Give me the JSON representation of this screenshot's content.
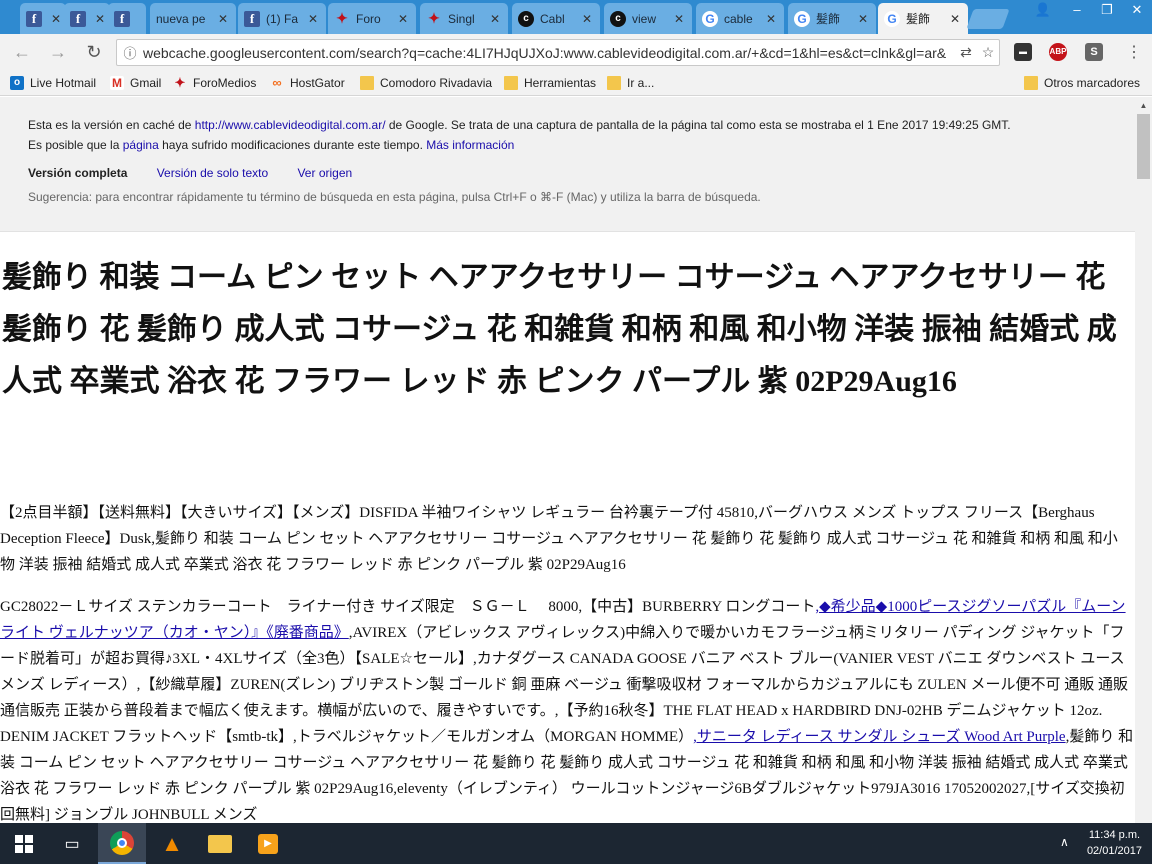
{
  "tabs": [
    {
      "icon": "f",
      "icon_kind": "facebook",
      "label": ""
    },
    {
      "icon": "f",
      "icon_kind": "facebook",
      "label": ""
    },
    {
      "icon": "f",
      "icon_kind": "facebook",
      "label": ""
    },
    {
      "icon": "",
      "icon_kind": "none",
      "label": "nueva pe"
    },
    {
      "icon": "f",
      "icon_kind": "facebook",
      "label": "(1) Fa"
    },
    {
      "icon": "✦",
      "icon_kind": "foromedios",
      "label": "Foro"
    },
    {
      "icon": "✦",
      "icon_kind": "foromedios",
      "label": "Singl"
    },
    {
      "icon": "c",
      "icon_kind": "cable",
      "label": "Cabl"
    },
    {
      "icon": "c",
      "icon_kind": "cable",
      "label": "view"
    },
    {
      "icon": "G",
      "icon_kind": "google",
      "label": "cable"
    },
    {
      "icon": "G",
      "icon_kind": "google",
      "label": "髪飾"
    },
    {
      "icon": "G",
      "icon_kind": "google",
      "label": "髪飾"
    }
  ],
  "address": {
    "url": "webcache.googleusercontent.com/search?q=cache:4LI7HJqUJXoJ:www.cablevideodigital.com.ar/+&cd=1&hl=es&ct=clnk&gl=ar&"
  },
  "extensions": [
    "ABP",
    "S"
  ],
  "bookmarks": [
    {
      "label": "Live Hotmail",
      "icon": "hotmail"
    },
    {
      "label": "Gmail",
      "icon": "gmail"
    },
    {
      "label": "ForoMedios",
      "icon": "foromedios"
    },
    {
      "label": "HostGator",
      "icon": "hostgator"
    },
    {
      "label": "Comodoro Rivadavia",
      "icon": "folder"
    },
    {
      "label": "Herramientas",
      "icon": "folder"
    },
    {
      "label": "Ir a...",
      "icon": "folder"
    },
    {
      "label": "Otros marcadores",
      "icon": "folder"
    }
  ],
  "cache_notice": {
    "prefix": "Esta es la versión en caché de ",
    "site_link": "http://www.cablevideodigital.com.ar/",
    "suffix": " de Google. Se trata de una captura de pantalla de la página tal como esta se mostraba el 1 Ene 2017 19:49:25 GMT.",
    "line2_prefix": "Es posible que la ",
    "line2_link": "página",
    "line2_middle": " haya sufrido modificaciones durante este tiempo. ",
    "line2_more": "Más información",
    "full_version": "Versión completa",
    "text_version": "Versión de solo texto",
    "view_source": "Ver origen",
    "tip": "Sugerencia: para encontrar rápidamente tu término de búsqueda en esta página, pulsa Ctrl+F o ⌘-F (Mac) y utiliza la barra de búsqueda."
  },
  "page": {
    "heading": "髪飾り 和装 コーム ピン セット ヘアアクセサリー コサージュ ヘアアクセサリー 花 髪飾り 花 髪飾り 成人式 コサージュ 花 和雑貨 和柄 和風 和小物 洋装 振袖 結婚式 成人式 卒業式 浴衣 花 フラワー レッド 赤 ピンク パープル 紫 02P29Aug16",
    "para1": "【2点目半額】【送料無料】【大きいサイズ】【メンズ】DISFIDA 半袖ワイシャツ レギュラー 台衿裏テープ付 45810,バーグハウス メンズ トップス フリース【Berghaus Deception Fleece】Dusk,髪飾り 和装 コーム ピン セット ヘアアクセサリー コサージュ ヘアアクセサリー 花 髪飾り 花 髪飾り 成人式 コサージュ 花 和雑貨 和柄 和風 和小物 洋装 振袖 結婚式 成人式 卒業式 浴衣 花 フラワー レッド 赤 ピンク パープル 紫 02P29Aug16",
    "para2_a": "GC28022－Ｌサイズ ステンカラーコート　ライナー付き サイズ限定　ＳＧ－Ｌ　 8000,【中古】BURBERRY ロングコート",
    "para2_link1": ",◆希少品◆1000ピースジグソーパズル『ムーンライト ヴェルナッツア（カオ・ヤン）』《廃番商品》",
    "para2_b": ",AVIREX（アビレックス アヴィレックス)中綿入りで暖かいカモフラージュ柄ミリタリー パディング ジャケット「フード脱着可」が超お買得♪3XL・4XLサイズ（全3色）【SALE☆セール】,カナダグース CANADA GOOSE バニア ベスト ブルー(VANIER VEST バニエ ダウンベスト ユース メンズ レディース）,【紗織草履】ZUREN(ズレン) ブリヂストン製 ゴールド 銅 亜麻 ベージュ 衝撃吸収材 フォーマルからカジュアルにも ZULEN メール便不可 通販 通販通信販売 正装から普段着まで幅広く使えます。横幅が広いので、履きやすいです。,【予約16秋冬】THE FLAT HEAD x HARDBIRD DNJ-02HB デニムジャケット 12oz. DENIM JACKET フラットヘッド【smtb-tk】,トラベルジャケット／モルガンオム（MORGAN HOMME）",
    "para2_link2": ",サニータ レディース サンダル シューズ Wood Art Purple",
    "para2_c": ",髪飾り 和装 コーム ピン セット ヘアアクセサリー コサージュ ヘアアクセサリー 花 髪飾り 花 髪飾り 成人式 コサージュ 花 和雑貨 和柄 和風 和小物 洋装 振袖 結婚式 成人式 卒業式 浴衣 花 フラワー レッド 赤 ピンク パープル 紫 02P29Aug16,eleventy（イレブンティ） ウールコットンジャージ6Bダブルジャケット979JA3016 17052002027,[サイズ交換初回無料] ジョンブル JOHNBULL メンズ"
  },
  "taskbar": {
    "time": "11:34 p.m.",
    "date": "02/01/2017"
  },
  "colors": {
    "tabstrip": "#2f8ad0",
    "link": "#1a0dab",
    "taskbar": "#1c2632"
  }
}
